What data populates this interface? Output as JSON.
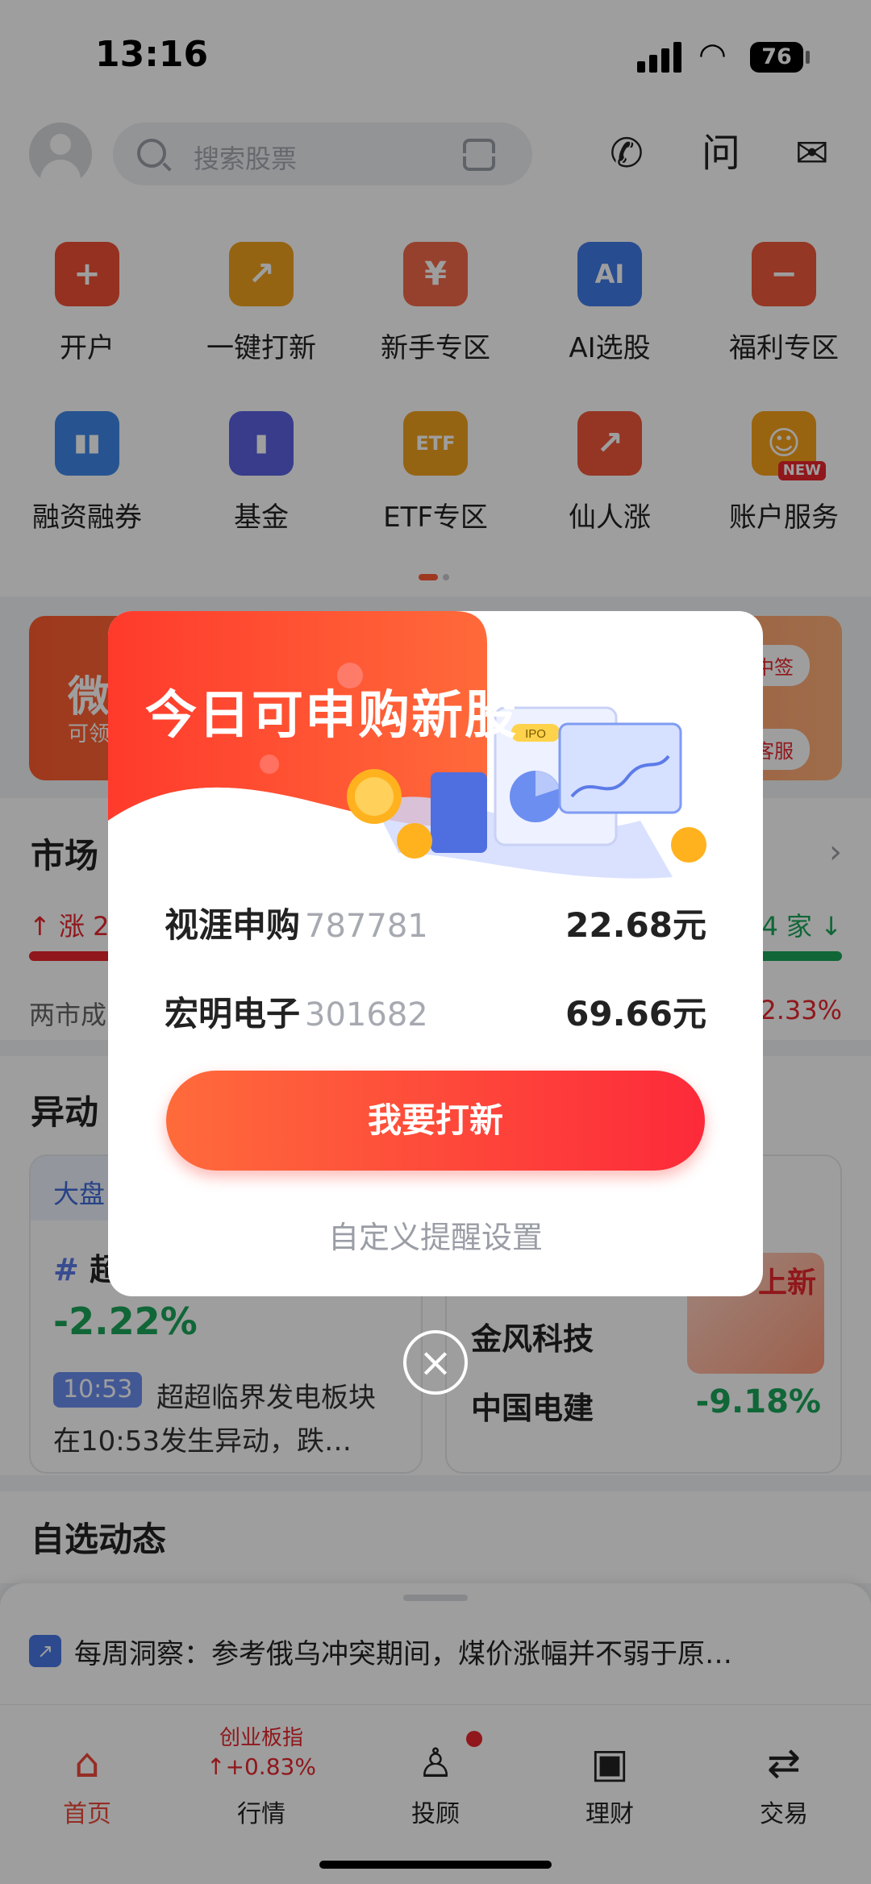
{
  "status": {
    "time": "13:16",
    "battery": "76"
  },
  "search": {
    "placeholder": "搜索股票"
  },
  "grid": {
    "row1": [
      {
        "label": "开户",
        "glyph": "+",
        "color": "#f04f34"
      },
      {
        "label": "一键打新",
        "glyph": "↗",
        "color": "#f0a21f"
      },
      {
        "label": "新手专区",
        "glyph": "¥",
        "color": "#f26a4b"
      },
      {
        "label": "AI选股",
        "glyph": "AI",
        "color": "#3f7be8"
      },
      {
        "label": "福利专区",
        "glyph": "−",
        "color": "#ef5a3a"
      }
    ],
    "row2": [
      {
        "label": "融资融券",
        "glyph": "▮▮",
        "color": "#3f88e8"
      },
      {
        "label": "基金",
        "glyph": "▮",
        "color": "#5b62e0"
      },
      {
        "label": "ETF专区",
        "glyph": "ETF",
        "color": "#f0a21f"
      },
      {
        "label": "仙人涨",
        "glyph": "↗",
        "color": "#f0583c"
      },
      {
        "label": "账户服务",
        "glyph": "☺",
        "color": "#f7a21b",
        "tag": "NEW"
      }
    ]
  },
  "banner": {
    "title": "微",
    "sub": "可领",
    "right1": "新股中签",
    "right2": "客服"
  },
  "market": {
    "title": "市场",
    "up_label": "涨 2",
    "down_label": "4 家",
    "turnover_label": "两市成",
    "turnover_change": "2.33%"
  },
  "anomaly": {
    "title": "异动",
    "card1": {
      "tab": "大盘",
      "name": "超",
      "change": "-2.22%",
      "time_badge": "10:53",
      "desc_line1": "超超临界发电板块",
      "desc_line2": "在10:53发生异动，跌…"
    },
    "card2": {
      "stock1": "金风科技",
      "stock2": "中国电建",
      "change": "-9.18%",
      "promo": "上新"
    }
  },
  "watchlist": {
    "title": "自选动态"
  },
  "feed": {
    "text": "每周洞察：参考俄乌冲突期间，煤价涨幅并不弱于原…"
  },
  "tabbar": {
    "tabs": [
      {
        "label": "首页",
        "icon": "home-icon",
        "active": true
      },
      {
        "label": "行情",
        "index_name": "创业板指",
        "index_change": "+0.83%"
      },
      {
        "label": "投顾",
        "badge": true
      },
      {
        "label": "理财"
      },
      {
        "label": "交易"
      }
    ]
  },
  "modal": {
    "title": "今日可申购新股",
    "ipo_badge": "IPO",
    "stocks": [
      {
        "name": "视涯申购",
        "code": "787781",
        "price": "22.68元"
      },
      {
        "name": "宏明电子",
        "code": "301682",
        "price": "69.66元"
      }
    ],
    "primary_button": "我要打新",
    "settings_link": "自定义提醒设置"
  }
}
